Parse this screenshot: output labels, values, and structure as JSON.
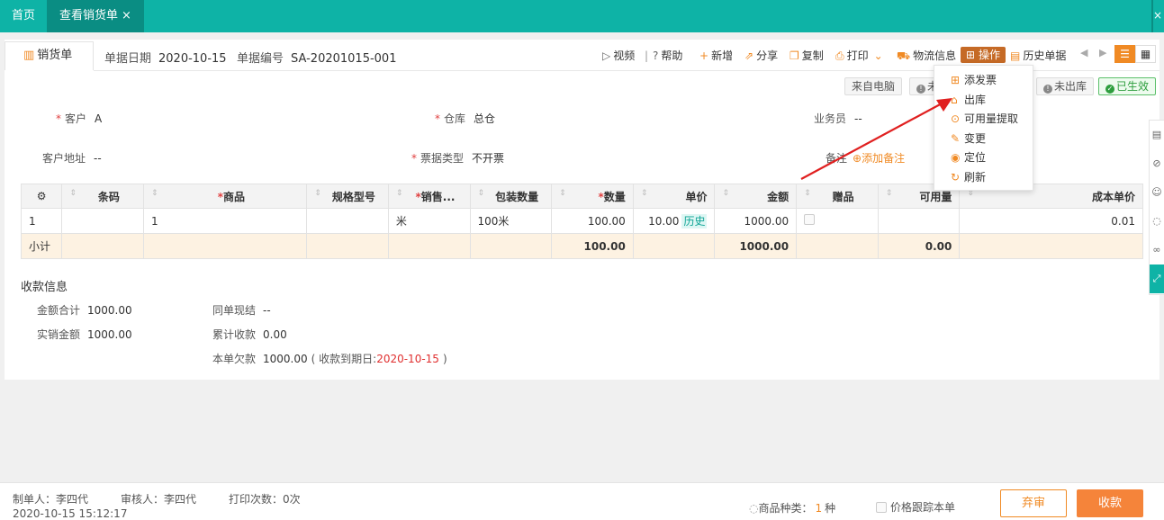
{
  "tabs": {
    "home": "首页",
    "active": "查看销货单",
    "close": "×",
    "edge_close": "×"
  },
  "doc": {
    "tab_label": "销货单",
    "date_label": "单据日期",
    "date_value": "2020-10-15",
    "no_label": "单据编号",
    "no_value": "SA-20201015-001"
  },
  "toolbar": {
    "video": "视频",
    "sep": "|",
    "help": "帮助",
    "add": "新增",
    "share": "分享",
    "copy": "复制",
    "print": "打印",
    "logistics": "物流信息",
    "operation": "操作",
    "history": "历史单据"
  },
  "status": {
    "source": "来自电脑",
    "partial": "未",
    "not_out": "未出库",
    "effective": "已生效"
  },
  "form": {
    "customer_label": "客户",
    "customer_value": "A",
    "warehouse_label": "仓库",
    "warehouse_value": "总仓",
    "salesman_label": "业务员",
    "salesman_value": "--",
    "address_label": "客户地址",
    "address_value": "--",
    "invoice_type_label": "票据类型",
    "invoice_type_value": "不开票",
    "remark_label": "备注",
    "add_remark": "添加备注"
  },
  "table": {
    "headers": [
      "",
      "条码",
      "商品",
      "规格型号",
      "销售...",
      "包装数量",
      "数量",
      "单价",
      "金额",
      "赠品",
      "可用量",
      "成本单价"
    ],
    "rows": [
      {
        "idx": "1",
        "barcode": "",
        "product": "1",
        "spec": "",
        "unit": "米",
        "pack": "100米",
        "qty": "100.00",
        "price": "10.00",
        "history": "历史",
        "amount": "1000.00",
        "gift": "",
        "available": "",
        "cost": "0.01"
      }
    ],
    "subtotal": {
      "label": "小计",
      "qty": "100.00",
      "amount": "1000.00",
      "available": "0.00"
    }
  },
  "payment": {
    "title": "收款信息",
    "total_label": "金额合计",
    "total_value": "1000.00",
    "actual_label": "实销金额",
    "actual_value": "1000.00",
    "same_label": "同单现结",
    "same_value": "--",
    "collected_label": "累计收款",
    "collected_value": "0.00",
    "owed_label": "本单欠款",
    "owed_value": "1000.00",
    "due_prefix": "( 收款到期日:",
    "due_value": "2020-10-15",
    "due_suffix": ")"
  },
  "dropdown": {
    "items": [
      "添发票",
      "出库",
      "可用量提取",
      "变更",
      "定位",
      "刷新"
    ]
  },
  "footer": {
    "maker": "制单人：李四代",
    "auditor": "审核人：李四代",
    "print_count": "打印次数：0次",
    "timestamp": "2020-10-15 15:12:17",
    "kinds_label": "商品种类：",
    "kinds_value": "1",
    "kinds_unit": "种",
    "track_label": "价格跟踪本单",
    "abandon": "弃审",
    "receive": "收款"
  },
  "colors": {
    "brand": "#0eb3a6",
    "accent": "#f08a24",
    "danger": "#e03030",
    "annotation_arrow": "#e02020"
  }
}
